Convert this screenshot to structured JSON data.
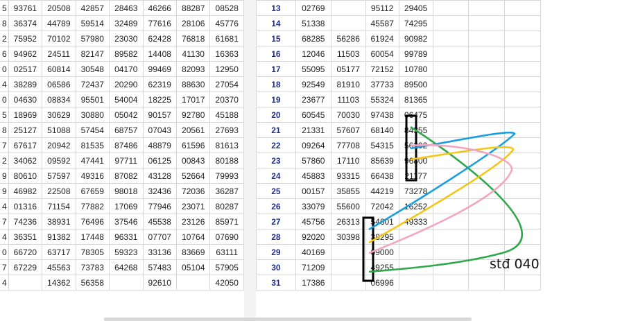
{
  "left_table": {
    "stubs": [
      "5",
      "8",
      "2",
      "6",
      "0",
      "4",
      "0",
      "5",
      "8",
      "7",
      "2",
      "9",
      "9",
      "4",
      "7",
      "4",
      "0",
      "7",
      "4"
    ],
    "rows": [
      [
        "93761",
        "20508",
        "42857",
        "28463",
        "46266",
        "88287",
        "08528"
      ],
      [
        "36374",
        "44789",
        "59514",
        "32489",
        "77616",
        "28106",
        "45776"
      ],
      [
        "75952",
        "70102",
        "57980",
        "23030",
        "62428",
        "76818",
        "61681"
      ],
      [
        "94962",
        "24511",
        "82147",
        "89582",
        "14408",
        "41130",
        "16363"
      ],
      [
        "02517",
        "60814",
        "30548",
        "04170",
        "99469",
        "82093",
        "12950"
      ],
      [
        "38289",
        "06586",
        "72437",
        "20290",
        "62319",
        "88630",
        "27054"
      ],
      [
        "04630",
        "08834",
        "95501",
        "54004",
        "18225",
        "17017",
        "20370"
      ],
      [
        "18969",
        "30629",
        "30880",
        "05042",
        "90157",
        "92780",
        "45188"
      ],
      [
        "25127",
        "51088",
        "57454",
        "68757",
        "07043",
        "20561",
        "27693"
      ],
      [
        "67617",
        "20942",
        "81535",
        "87486",
        "48879",
        "61596",
        "81613"
      ],
      [
        "34062",
        "09592",
        "47441",
        "97711",
        "06125",
        "00843",
        "80188"
      ],
      [
        "80610",
        "57597",
        "49316",
        "87082",
        "43128",
        "52664",
        "79993"
      ],
      [
        "46982",
        "22508",
        "67659",
        "98018",
        "32436",
        "72036",
        "36287"
      ],
      [
        "01316",
        "71154",
        "77882",
        "17069",
        "77946",
        "23071",
        "80287"
      ],
      [
        "74236",
        "38931",
        "76496",
        "37546",
        "45538",
        "23126",
        "85971"
      ],
      [
        "36351",
        "91382",
        "17448",
        "96331",
        "07707",
        "10764",
        "07690"
      ],
      [
        "66720",
        "63717",
        "78305",
        "59323",
        "33136",
        "83669",
        "63111"
      ],
      [
        "67229",
        "45563",
        "73783",
        "64268",
        "57483",
        "05104",
        "57905"
      ],
      [
        "",
        "14362",
        "56358",
        "",
        "92610",
        "",
        "42050"
      ]
    ]
  },
  "right_table": {
    "rows": [
      [
        "13",
        "02769",
        "",
        "95112",
        "29405"
      ],
      [
        "14",
        "51338",
        "",
        "45587",
        "74295"
      ],
      [
        "15",
        "68285",
        "56286",
        "61924",
        "90982"
      ],
      [
        "16",
        "12046",
        "11503",
        "60054",
        "99789"
      ],
      [
        "17",
        "55095",
        "05177",
        "72152",
        "10780"
      ],
      [
        "18",
        "92549",
        "81910",
        "37733",
        "89500"
      ],
      [
        "19",
        "23677",
        "11103",
        "55324",
        "81365"
      ],
      [
        "20",
        "60545",
        "70030",
        "97438",
        "06475"
      ],
      [
        "21",
        "21331",
        "57607",
        "68140",
        "84355"
      ],
      [
        "22",
        "09264",
        "77708",
        "54315",
        "56202"
      ],
      [
        "23",
        "57860",
        "17110",
        "85639",
        "96800"
      ],
      [
        "24",
        "45883",
        "93315",
        "66438",
        "21177"
      ],
      [
        "25",
        "00157",
        "35855",
        "44219",
        "73278"
      ],
      [
        "26",
        "33079",
        "55600",
        "72042",
        "16252"
      ],
      [
        "27",
        "45756",
        "26313",
        "54601",
        "49333"
      ],
      [
        "28",
        "92020",
        "30398",
        "38295",
        ""
      ],
      [
        "29",
        "40169",
        "",
        "09000",
        ""
      ],
      [
        "30",
        "71209",
        "",
        "49255",
        ""
      ],
      [
        "31",
        "17386",
        "",
        "06996",
        ""
      ]
    ]
  },
  "annotation": {
    "note_text": "stđ 040",
    "colors": {
      "box": "#000000",
      "green": "#2ea84a",
      "blue": "#1a9ee0",
      "yellow": "#f5c518",
      "pink": "#f2a6c0"
    }
  }
}
